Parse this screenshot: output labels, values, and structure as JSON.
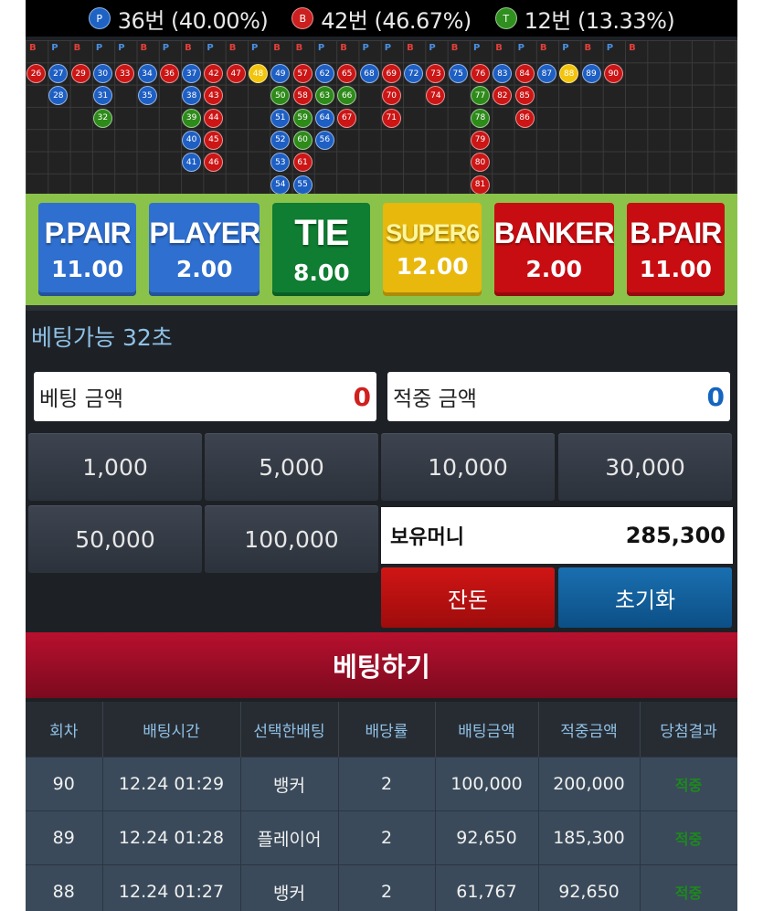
{
  "stats": {
    "player": {
      "badge": "P",
      "text": "36번 (40.00%)",
      "color": "#1e63c4"
    },
    "banker": {
      "badge": "B",
      "text": "42번 (46.67%)",
      "color": "#cc1f1f"
    },
    "tie": {
      "badge": "T",
      "text": "12번 (13.33%)",
      "color": "#2f8f1f"
    }
  },
  "road": {
    "header_letters": [
      "B",
      "P",
      "B",
      "P",
      "P",
      "B",
      "P",
      "B",
      "P",
      "B",
      "P",
      "B",
      "B",
      "P",
      "B",
      "P",
      "P",
      "B",
      "P",
      "B",
      "P",
      "B",
      "P",
      "B",
      "P",
      "B",
      "P",
      "B"
    ],
    "columns": [
      [
        "26B"
      ],
      [
        "27P",
        "28P"
      ],
      [
        "29B"
      ],
      [
        "30P",
        "31P",
        "32T"
      ],
      [
        "33B"
      ],
      [
        "34P",
        "35P"
      ],
      [
        "36B"
      ],
      [
        "37P",
        "38P",
        "39T",
        "40P",
        "41P"
      ],
      [
        "42B",
        "43B",
        "44B",
        "45B",
        "46B"
      ],
      [
        "47B"
      ],
      [
        "48Y"
      ],
      [
        "49P",
        "50T",
        "51P",
        "52P",
        "53P",
        "54P"
      ],
      [
        "57B",
        "58B",
        "59T",
        "60T",
        "61B",
        "55P"
      ],
      [
        "62P",
        "63T",
        "64P",
        "56P"
      ],
      [
        "65B",
        "66T",
        "67B"
      ],
      [
        "68P"
      ],
      [
        "69B",
        "70B",
        "71B"
      ],
      [
        "72P"
      ],
      [
        "73B",
        "74B"
      ],
      [
        "75P"
      ],
      [
        "76B",
        "77T",
        "78T",
        "79B",
        "80B",
        "81B"
      ],
      [
        "83P",
        "82B"
      ],
      [
        "84B",
        "85B",
        "86B"
      ],
      [
        "87P"
      ],
      [
        "88Y"
      ],
      [
        "89P"
      ],
      [
        "90B"
      ]
    ]
  },
  "bets": [
    {
      "name": "P.PAIR",
      "odds": "11.00",
      "color": "#2f6fcf"
    },
    {
      "name": "PLAYER",
      "odds": "2.00",
      "color": "#2f6fcf"
    },
    {
      "name": "TIE",
      "odds": "8.00",
      "color": "#0f7d32"
    },
    {
      "name": "SUPER6",
      "odds": "12.00",
      "color": "#e8b80c"
    },
    {
      "name": "BANKER",
      "odds": "2.00",
      "color": "#c80d12"
    },
    {
      "name": "B.PAIR",
      "odds": "11.00",
      "color": "#c80d12"
    }
  ],
  "timer": "베팅가능 32초",
  "bet_amount": {
    "label": "베팅 금액",
    "value": "0"
  },
  "win_amount": {
    "label": "적중 금액",
    "value": "0"
  },
  "chips": [
    "1,000",
    "5,000",
    "10,000",
    "30,000",
    "50,000",
    "100,000"
  ],
  "balance": {
    "label": "보유머니",
    "value": "285,300"
  },
  "buttons": {
    "change": "잔돈",
    "reset": "초기화",
    "place_bet": "베팅하기"
  },
  "history": {
    "headers": [
      "회차",
      "배팅시간",
      "선택한배팅",
      "배당률",
      "배팅금액",
      "적중금액",
      "당첨결과"
    ],
    "rows": [
      [
        "90",
        "12.24 01:29",
        "뱅커",
        "2",
        "100,000",
        "200,000",
        "적중"
      ],
      [
        "89",
        "12.24 01:28",
        "플레이어",
        "2",
        "92,650",
        "185,300",
        "적중"
      ],
      [
        "88",
        "12.24 01:27",
        "뱅커",
        "2",
        "61,767",
        "92,650",
        "적중"
      ]
    ]
  }
}
